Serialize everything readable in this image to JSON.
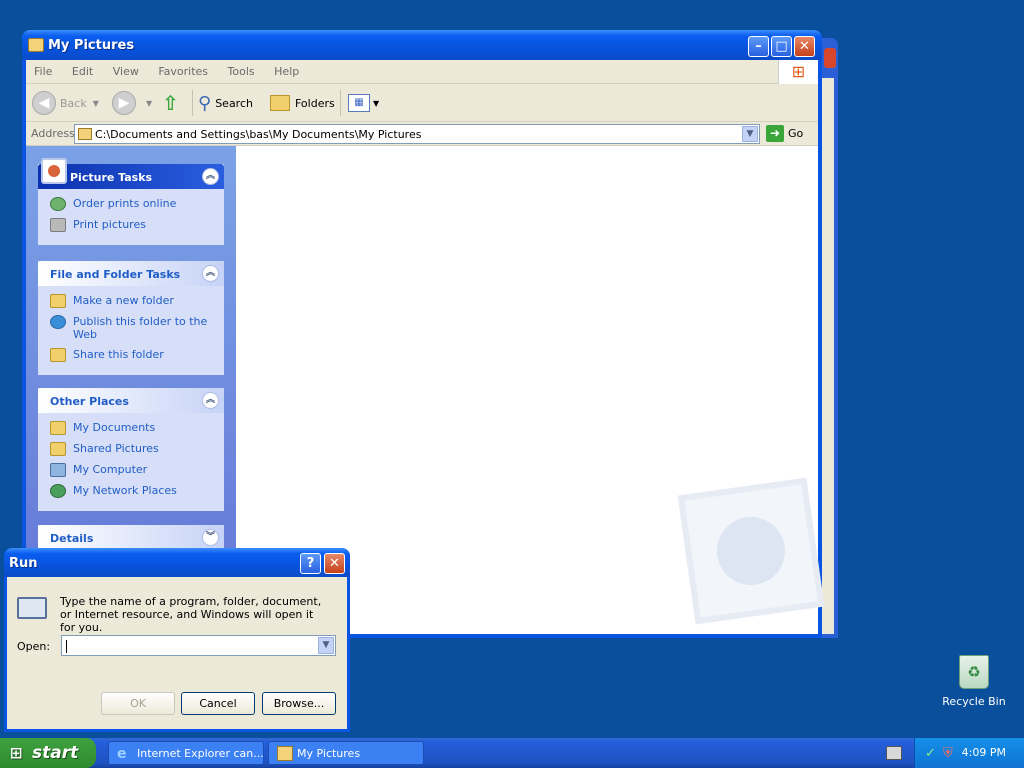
{
  "explorer": {
    "title": "My Pictures",
    "menu": [
      "File",
      "Edit",
      "View",
      "Favorites",
      "Tools",
      "Help"
    ],
    "toolbar": {
      "back_label": "Back",
      "search_label": "Search",
      "folders_label": "Folders"
    },
    "address": {
      "label": "Address",
      "value": "C:\\Documents and Settings\\bas\\My Documents\\My Pictures",
      "go_label": "Go"
    },
    "panels": [
      {
        "title": "Picture Tasks",
        "tasks": [
          {
            "label": "Order prints online",
            "icon": "globe-icon"
          },
          {
            "label": "Print pictures",
            "icon": "printer-icon"
          }
        ]
      },
      {
        "title": "File and Folder Tasks",
        "tasks": [
          {
            "label": "Make a new folder",
            "icon": "new-folder-icon"
          },
          {
            "label": "Publish this folder to the Web",
            "icon": "globe-icon"
          },
          {
            "label": "Share this folder",
            "icon": "share-folder-icon"
          }
        ]
      },
      {
        "title": "Other Places",
        "tasks": [
          {
            "label": "My Documents",
            "icon": "folder-icon"
          },
          {
            "label": "Shared Pictures",
            "icon": "folder-icon"
          },
          {
            "label": "My Computer",
            "icon": "computer-icon"
          },
          {
            "label": "My Network Places",
            "icon": "network-icon"
          }
        ]
      },
      {
        "title": "Details",
        "tasks": []
      }
    ]
  },
  "run_dialog": {
    "title": "Run",
    "help_button": "?",
    "description": "Type the name of a program, folder, document, or Internet resource, and Windows will open it for you.",
    "open_label": "Open:",
    "open_value": "",
    "ok_label": "OK",
    "cancel_label": "Cancel",
    "browse_label": "Browse..."
  },
  "desktop": {
    "recycle_bin_label": "Recycle Bin"
  },
  "taskbar": {
    "start_label": "start",
    "tasks": [
      "Internet Explorer can...",
      "My Pictures"
    ],
    "clock": "4:09 PM"
  }
}
